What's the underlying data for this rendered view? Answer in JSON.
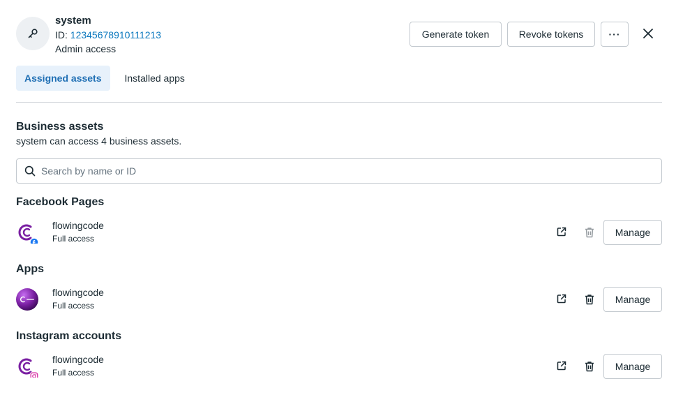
{
  "header": {
    "name": "system",
    "id_label": "ID:",
    "id_value": "12345678910111213",
    "role": "Admin access",
    "generate_label": "Generate token",
    "revoke_label": "Revoke tokens",
    "more_label": "···"
  },
  "tabs": [
    {
      "label": "Assigned assets",
      "active": true
    },
    {
      "label": "Installed apps",
      "active": false
    }
  ],
  "business_assets": {
    "title": "Business assets",
    "description": "system can access 4 business assets.",
    "search_placeholder": "Search by name or ID"
  },
  "sections": [
    {
      "title": "Facebook Pages",
      "item": {
        "name": "flowingcode",
        "access": "Full access",
        "badge": "facebook-badge",
        "manage_label": "Manage"
      }
    },
    {
      "title": "Apps",
      "item": {
        "name": "flowingcode",
        "access": "Full access",
        "badge": "none",
        "manage_label": "Manage"
      }
    },
    {
      "title": "Instagram accounts",
      "item": {
        "name": "flowingcode",
        "access": "Full access",
        "badge": "instagram-badge",
        "manage_label": "Manage"
      }
    }
  ],
  "colors": {
    "link": "#0a78be",
    "active_tab_bg": "#e7f1fb",
    "brand_purple": "#7a1fa2",
    "facebook_blue": "#1877f2",
    "instagram_pink": "#d6249f"
  }
}
